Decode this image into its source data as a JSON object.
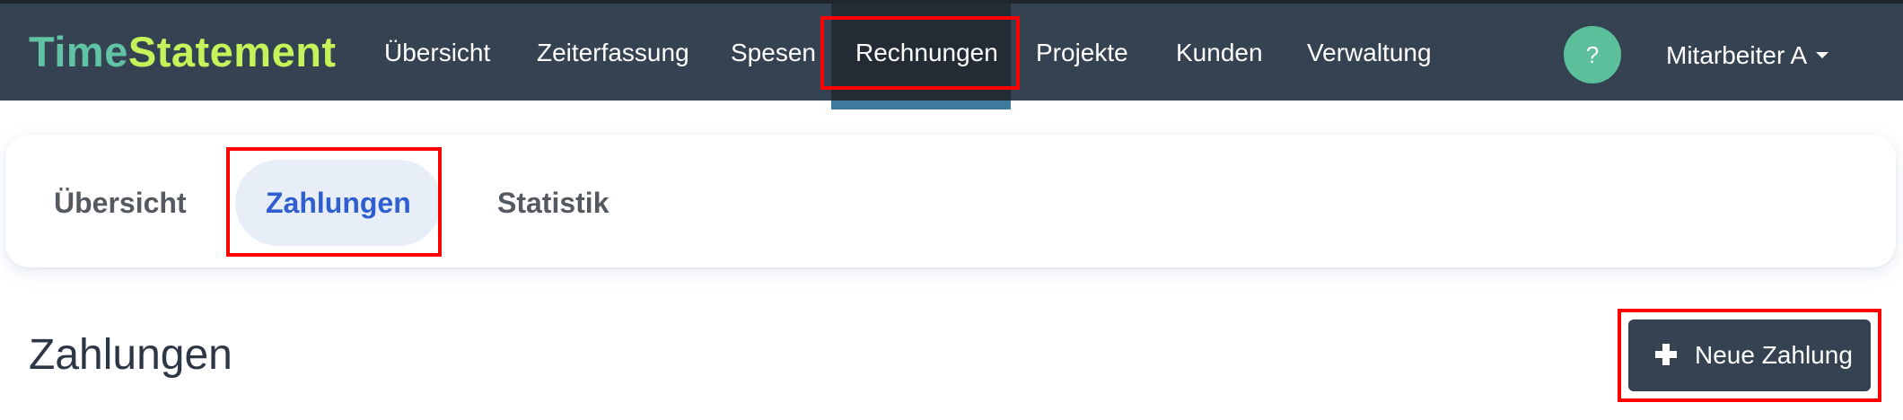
{
  "brand": {
    "part1": "Time",
    "part2": "Statement"
  },
  "nav": {
    "items": [
      {
        "label": "Übersicht"
      },
      {
        "label": "Zeiterfassung"
      },
      {
        "label": "Spesen"
      },
      {
        "label": "Rechnungen",
        "active": true
      },
      {
        "label": "Projekte"
      },
      {
        "label": "Kunden"
      },
      {
        "label": "Verwaltung"
      }
    ],
    "help_label": "?",
    "user_label": "Mitarbeiter A"
  },
  "tabs": [
    {
      "label": "Übersicht"
    },
    {
      "label": "Zahlungen",
      "active": true
    },
    {
      "label": "Statistik"
    }
  ],
  "page": {
    "title": "Zahlungen",
    "new_button_label": "Neue Zahlung"
  },
  "colors": {
    "topbar": "#354252",
    "active_nav": "#232b35",
    "nav_underline": "#3d7a9e",
    "brand_time": "#5fc3a4",
    "brand_statement": "#c8f25a",
    "help_button": "#5cbf9b",
    "active_tab_bg": "#e8eef8",
    "active_tab_text": "#2f5fcf",
    "highlight": "#ff0000"
  },
  "icons": {
    "new_button": "plus-icon",
    "user_menu": "caret-down-icon"
  }
}
